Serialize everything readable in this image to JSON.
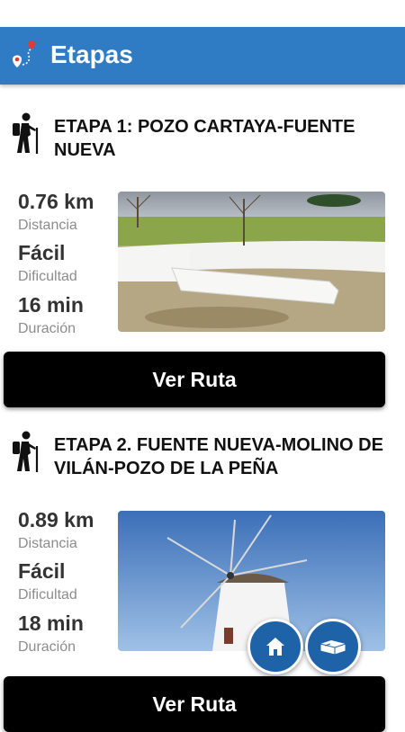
{
  "header": {
    "title": "Etapas"
  },
  "stages": [
    {
      "title": "ETAPA 1: POZO CARTAYA-FUENTE NUEVA",
      "distance_value": "0.76 km",
      "distance_label": "Distancia",
      "difficulty_value": "Fácil",
      "difficulty_label": "Dificultad",
      "duration_value": "16 min",
      "duration_label": "Duración",
      "button_label": "Ver Ruta"
    },
    {
      "title": "ETAPA 2. FUENTE NUEVA-MOLINO DE VILÁN-POZO DE LA PEÑA",
      "distance_value": "0.89 km",
      "distance_label": "Distancia",
      "difficulty_value": "Fácil",
      "difficulty_label": "Dificultad",
      "duration_value": "18 min",
      "duration_label": "Duración",
      "button_label": "Ver Ruta"
    }
  ],
  "fabs": {
    "home_icon": "home-icon",
    "map_icon": "map-icon"
  },
  "colors": {
    "header": "#2f7cc4",
    "button": "#000000",
    "fab": "#1e63a8"
  }
}
